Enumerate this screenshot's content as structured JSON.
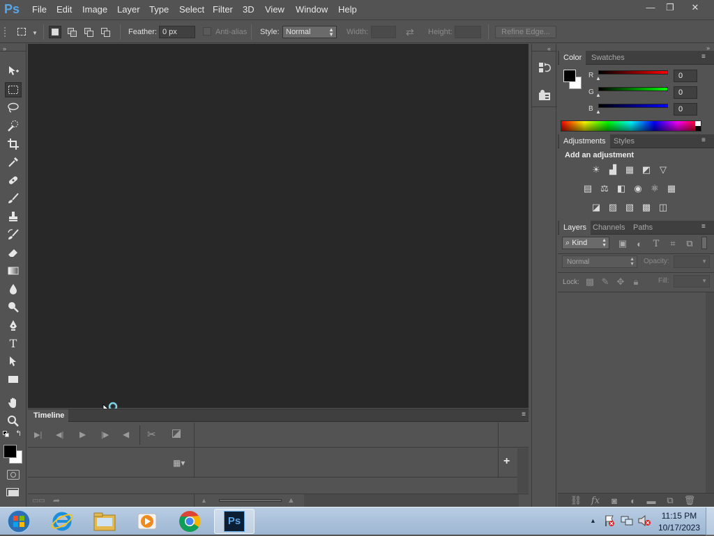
{
  "app": {
    "logo": "Ps",
    "menu": [
      "File",
      "Edit",
      "Image",
      "Layer",
      "Type",
      "Select",
      "Filter",
      "3D",
      "View",
      "Window",
      "Help"
    ],
    "window_controls": {
      "minimize": "—",
      "restore": "❐",
      "close": "✕"
    }
  },
  "options_bar": {
    "feather_label": "Feather:",
    "feather_value": "0 px",
    "antialias_label": "Anti-alias",
    "style_label": "Style:",
    "style_value": "Normal",
    "width_label": "Width:",
    "height_label": "Height:",
    "refine_edge_label": "Refine Edge..."
  },
  "tools": [
    "move-tool",
    "rectangular-marquee-tool",
    "lasso-tool",
    "quick-selection-tool",
    "crop-tool",
    "eyedropper-tool",
    "spot-healing-tool",
    "brush-tool",
    "clone-stamp-tool",
    "history-brush-tool",
    "eraser-tool",
    "gradient-tool",
    "blur-tool",
    "dodge-tool",
    "pen-tool",
    "type-tool",
    "path-selection-tool",
    "rectangle-tool",
    "hand-tool",
    "zoom-tool"
  ],
  "colors": {
    "foreground": "#000000",
    "background": "#ffffff",
    "canvas_bg": "#282828",
    "ui_bg": "#535353",
    "accent": "#5aa5e6"
  },
  "timeline": {
    "tab_label": "Timeline",
    "add_button": "+"
  },
  "color_panel": {
    "tabs": [
      "Color",
      "Swatches"
    ],
    "channels": [
      {
        "label": "R",
        "value": "0",
        "color": "#ff0000"
      },
      {
        "label": "G",
        "value": "0",
        "color": "#00ff00"
      },
      {
        "label": "B",
        "value": "0",
        "color": "#0000ff"
      }
    ]
  },
  "adjustments_panel": {
    "tabs": [
      "Adjustments",
      "Styles"
    ],
    "heading": "Add an adjustment"
  },
  "layers_panel": {
    "tabs": [
      "Layers",
      "Channels",
      "Paths"
    ],
    "filter_kind": "Kind",
    "blend_mode": "Normal",
    "opacity_label": "Opacity:",
    "lock_label": "Lock:",
    "fill_label": "Fill:"
  },
  "taskbar": {
    "apps": [
      "start-orb",
      "internet-explorer",
      "file-explorer",
      "media-player",
      "chrome",
      "photoshop"
    ],
    "clock_time": "11:15 PM",
    "clock_date": "10/17/2023"
  }
}
